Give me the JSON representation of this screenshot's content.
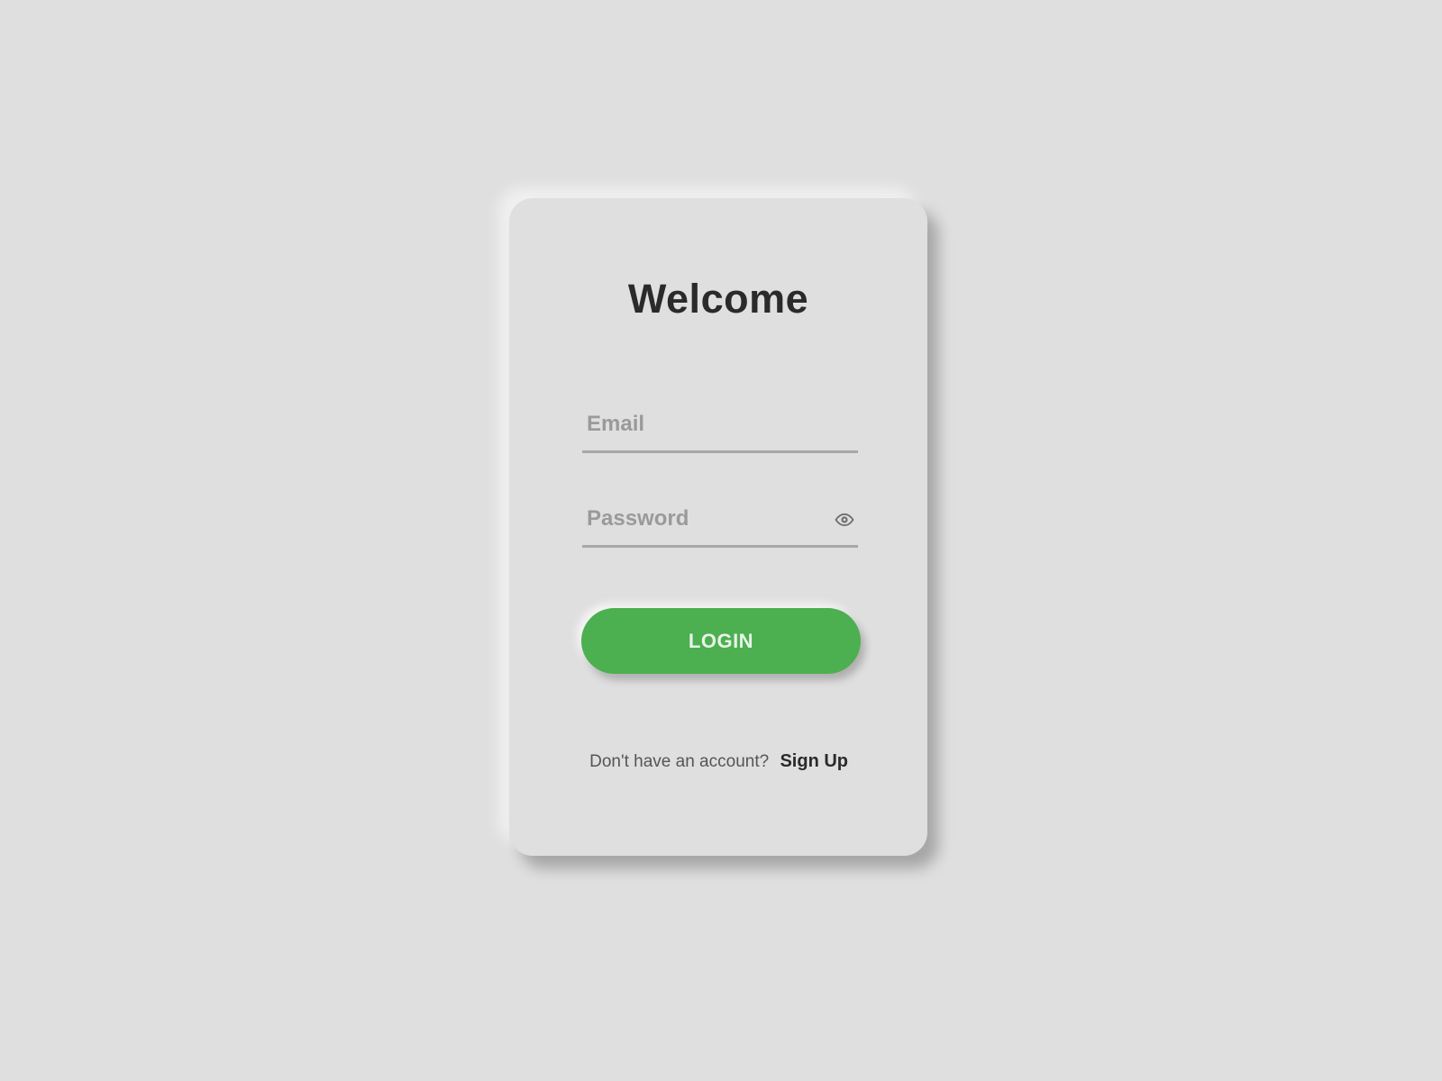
{
  "login_card": {
    "title": "Welcome",
    "email_placeholder": "Email",
    "password_placeholder": "Password",
    "login_label": "LOGIN",
    "signup_prompt": "Don't have an account?",
    "signup_label": "Sign Up",
    "password_toggle_icon": "eye-icon"
  },
  "colors": {
    "background": "#dfdfdf",
    "accent": "#4caf50",
    "title": "#2a2a2a"
  }
}
